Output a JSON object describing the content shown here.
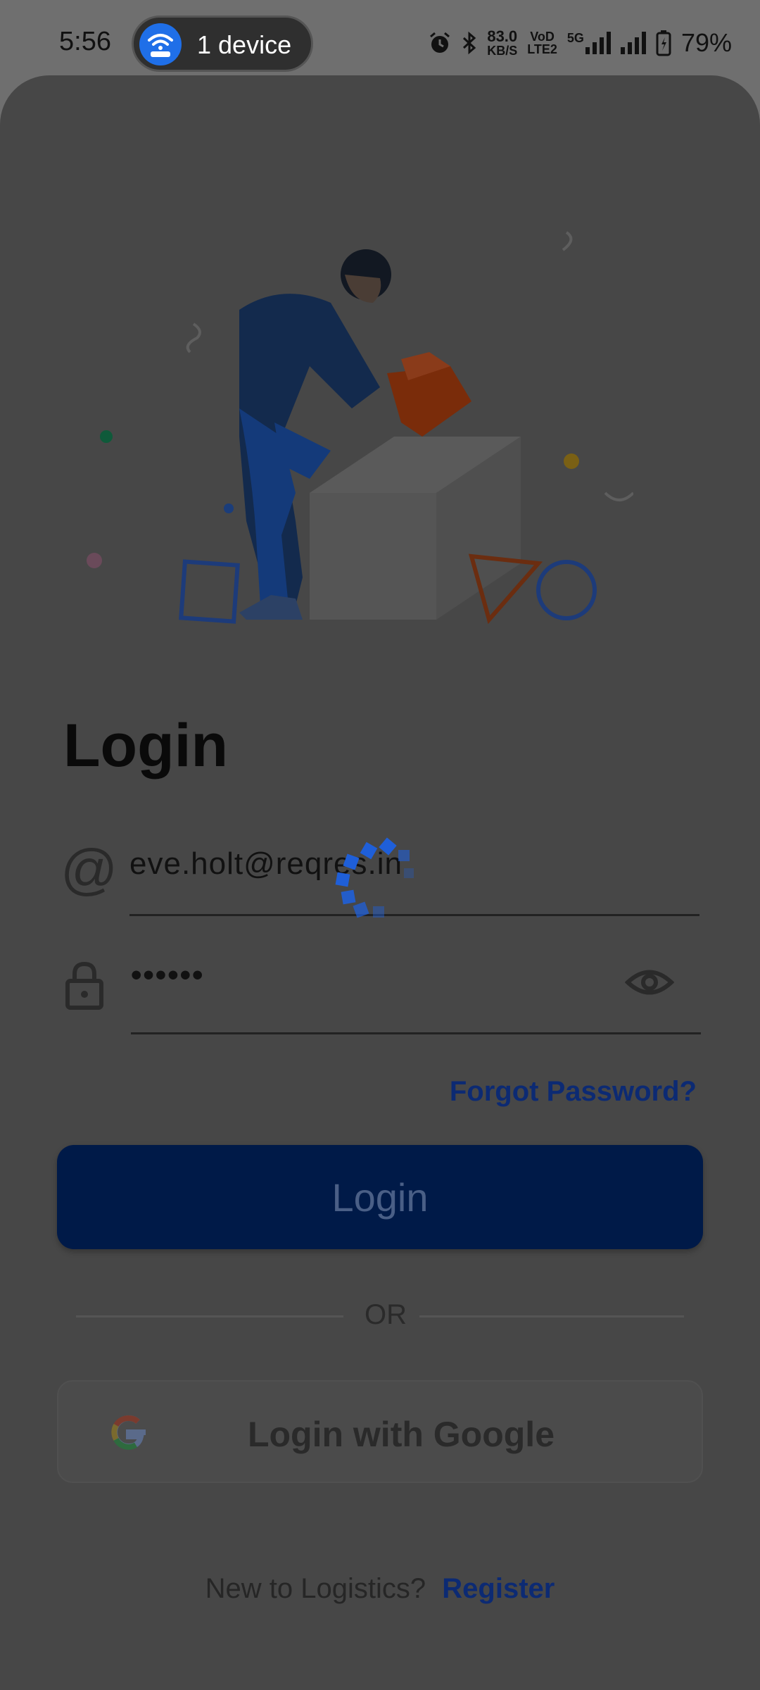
{
  "status_bar": {
    "time": "5:56",
    "hotspot_label": "1 device",
    "net_speed_value": "83.0",
    "net_speed_unit": "KB/S",
    "volte_top": "VoD",
    "volte_bottom": "LTE2",
    "network_type": "5G",
    "battery": "79%"
  },
  "login": {
    "title": "Login",
    "email_value": "eve.holt@reqres.in",
    "password_value": "••••••",
    "forgot_password": "Forgot Password?",
    "login_button": "Login",
    "or_separator": "OR",
    "google_button": "Login with Google",
    "register_prompt": "New to Logistics?",
    "register_link": "Register"
  },
  "icons": {
    "email": "at-icon",
    "password": "lock-icon",
    "visibility": "eye-icon",
    "google": "google-logo-icon",
    "loading": "loading-spinner"
  },
  "colors": {
    "accent": "#0c2a73",
    "button_bg": "#001a48",
    "spinner": "#1f5fd8"
  }
}
